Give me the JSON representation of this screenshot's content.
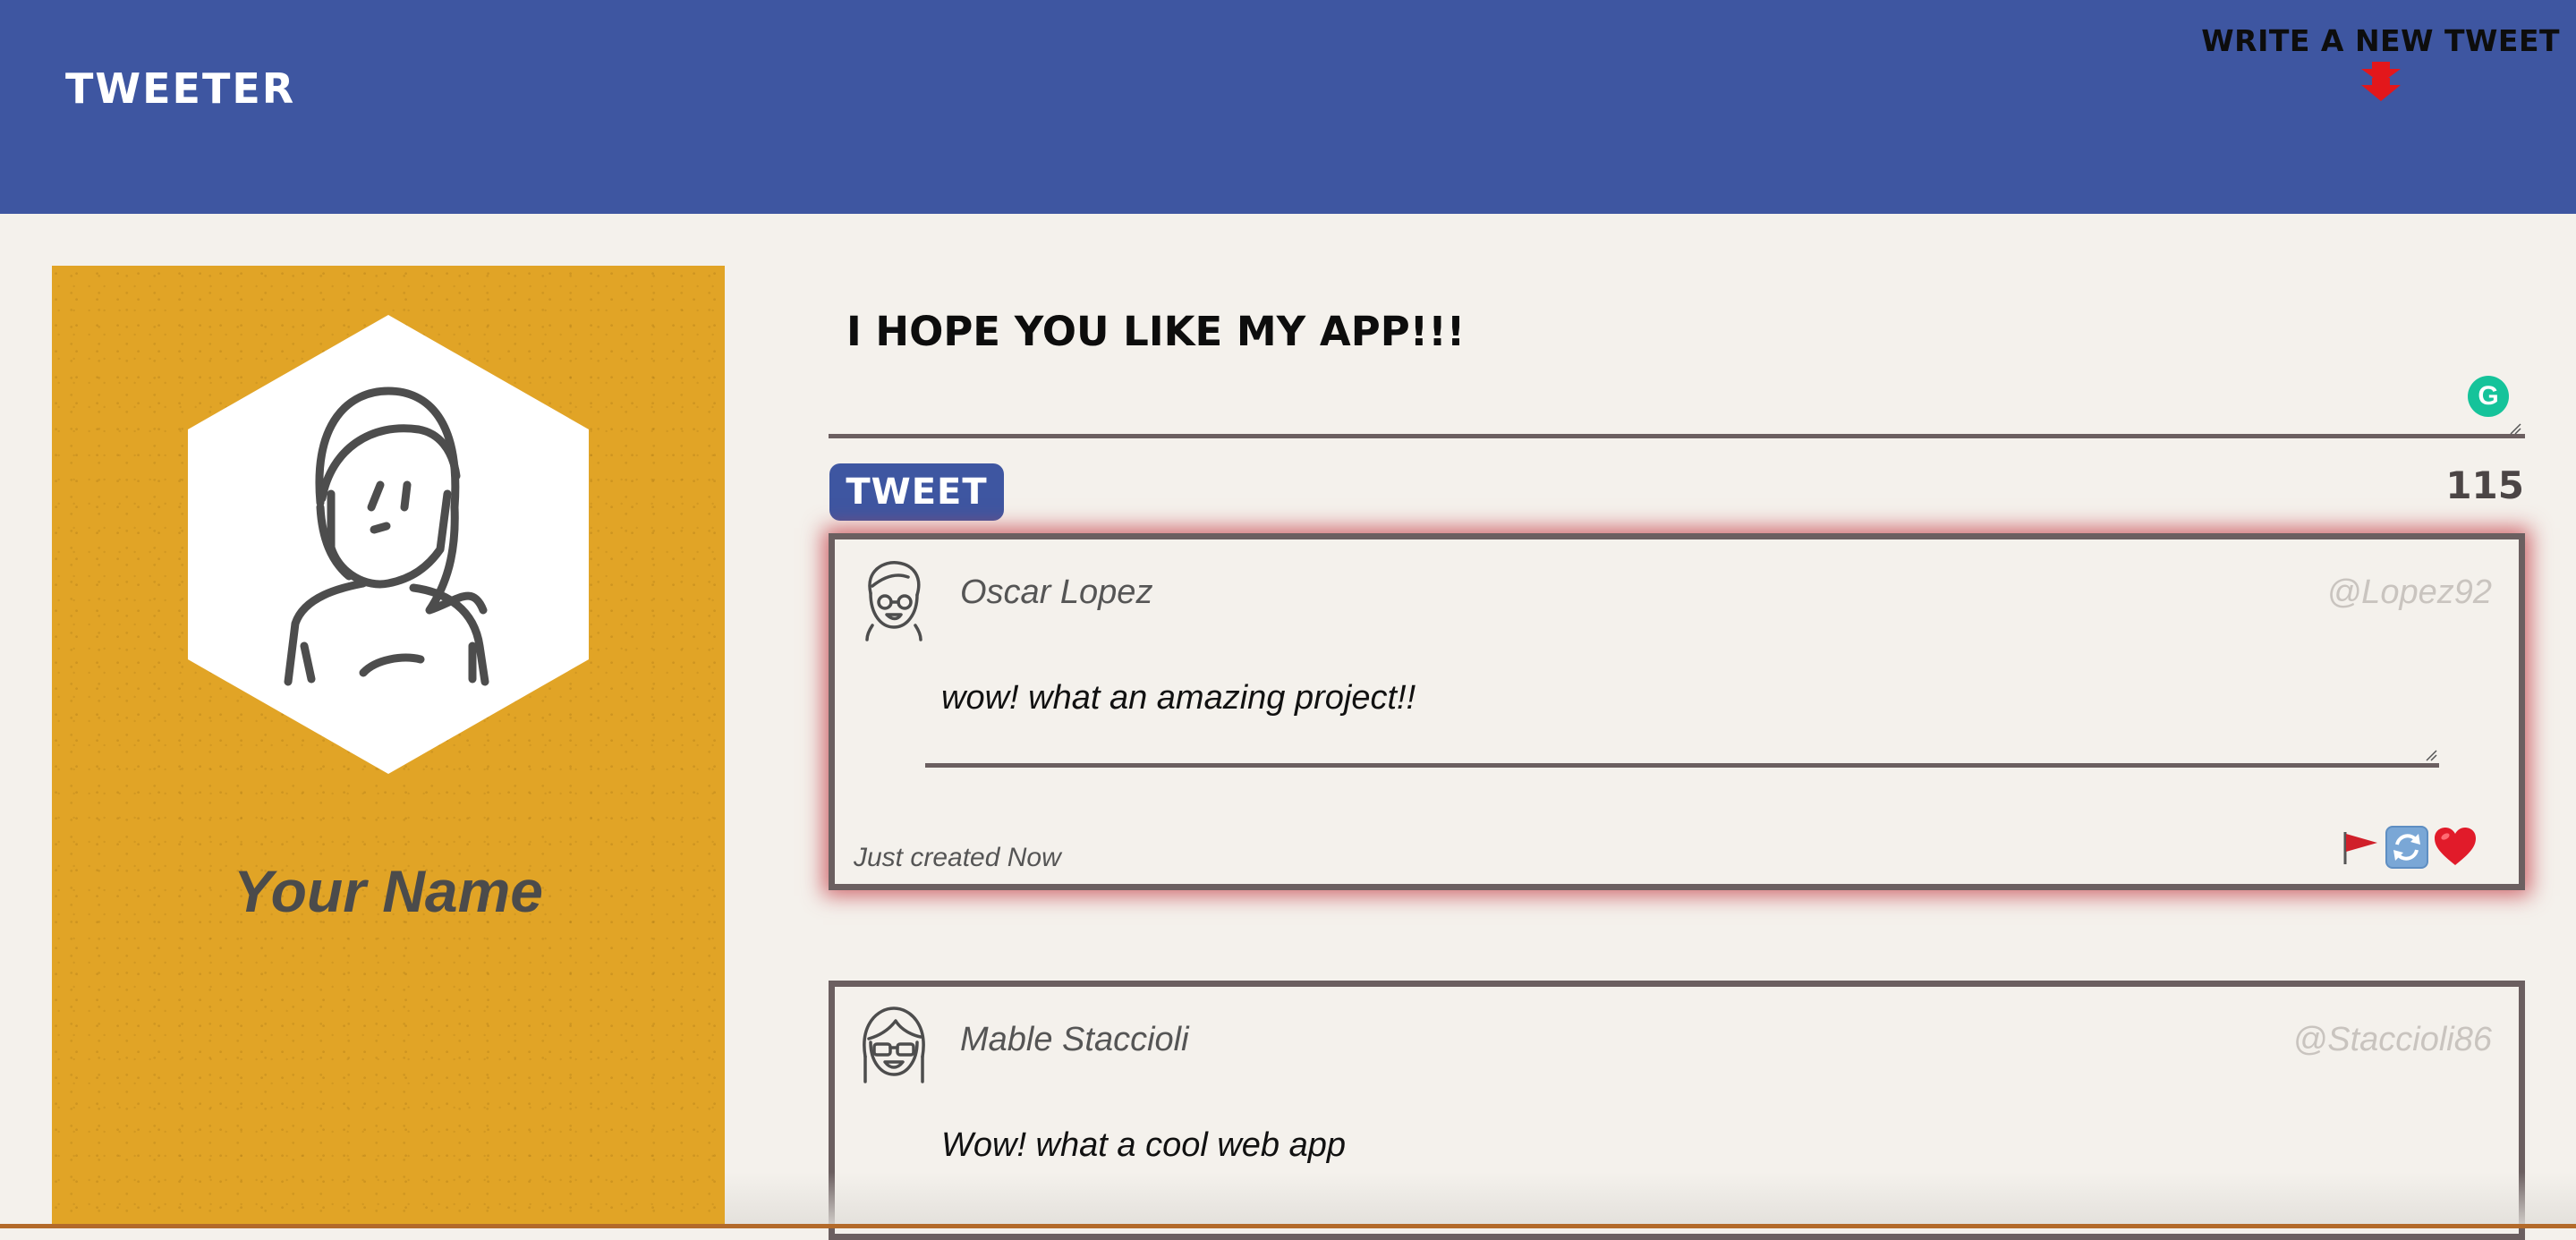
{
  "nav": {
    "brand": "TWEETER",
    "write_new": "WRITE A NEW TWEET"
  },
  "profile": {
    "name": "Your Name"
  },
  "compose": {
    "text": "I HOPE YOU LIKE MY APP!!!",
    "button_label": "TWEET",
    "counter": "115"
  },
  "tweets": [
    {
      "name": "Oscar Lopez",
      "handle": "@Lopez92",
      "content": "wow! what an amazing project!!",
      "timestamp": "Just created Now",
      "actions": [
        "flag-icon",
        "retweet-icon",
        "heart-icon"
      ]
    },
    {
      "name": "Mable Staccioli",
      "handle": "@Staccioli86",
      "content": "Wow! what a cool web app"
    }
  ],
  "colors": {
    "nav": "#3e56a1",
    "profile_card": "#e1a426",
    "background": "#f4f1ec",
    "tweet_border": "#6b5f60",
    "highlight_shadow": "#c43c46",
    "grammarly": "#15c39a"
  }
}
